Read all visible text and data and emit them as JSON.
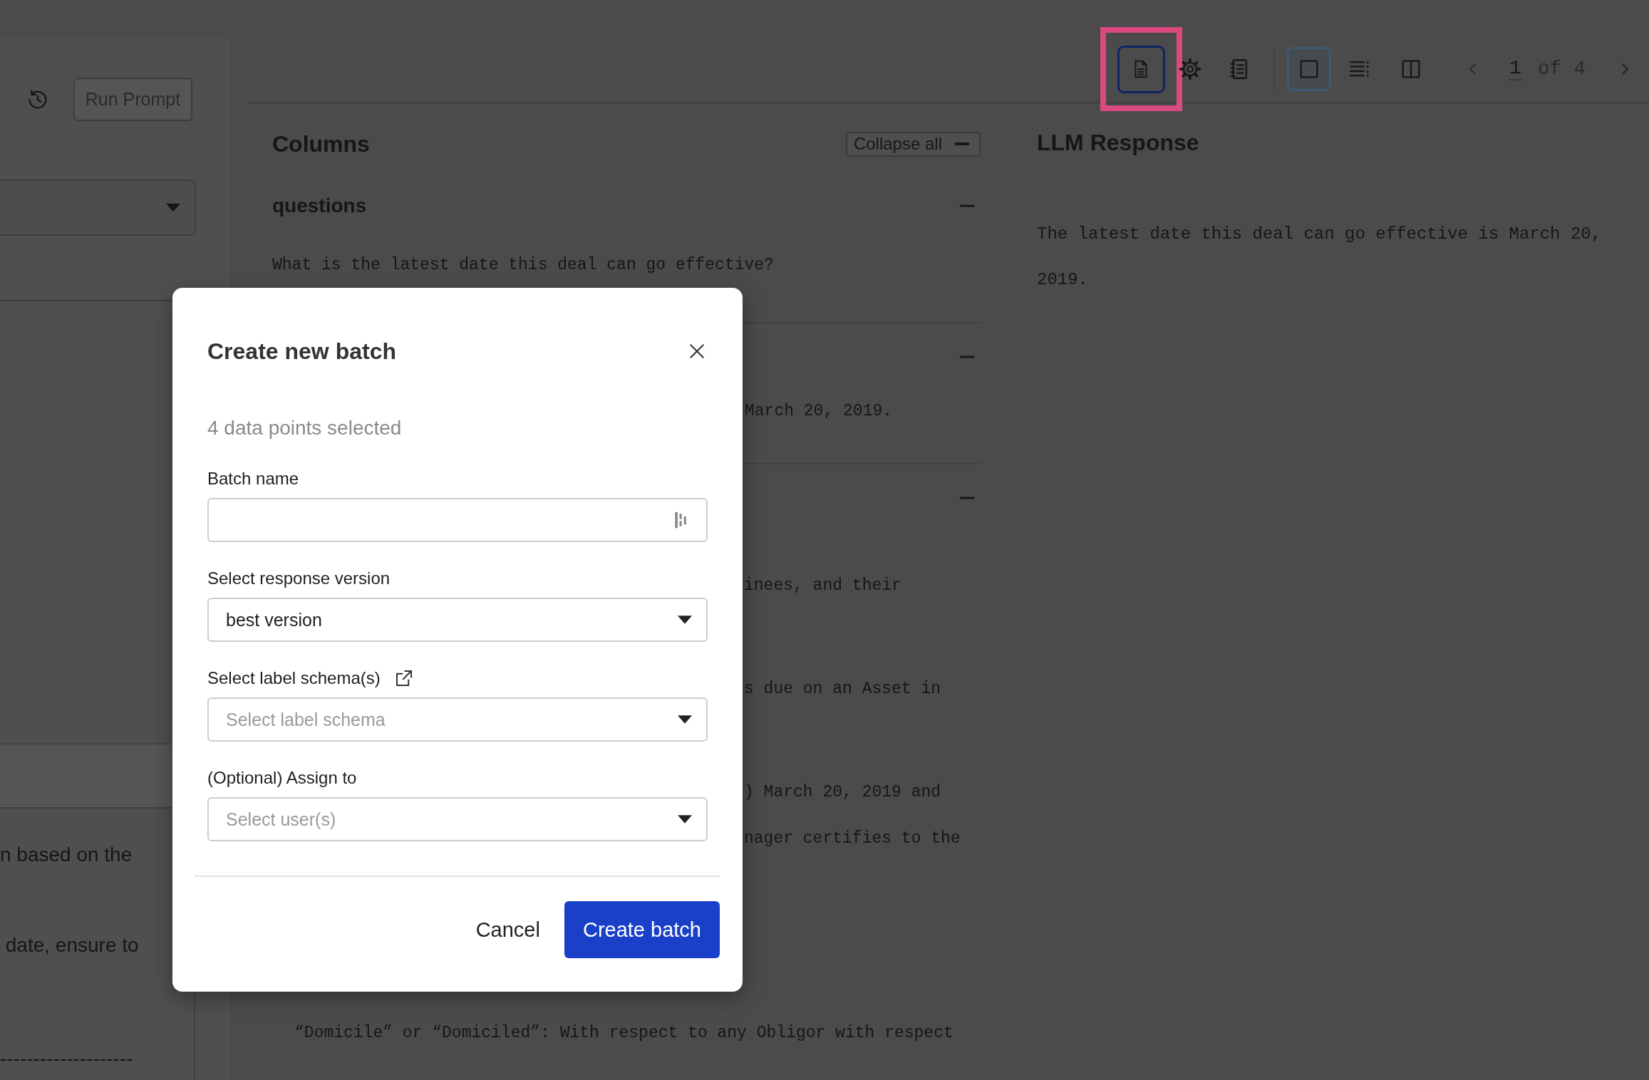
{
  "left_panel": {
    "run_button": {
      "label": "Run Prompt",
      "disabled": true
    },
    "text_lines": [
      "n based on the",
      " date, ensure to",
      "--------------------"
    ]
  },
  "toolbar": {
    "tools": [
      {
        "kind": "document",
        "selected": true,
        "highlighted": true
      },
      {
        "kind": "settings",
        "selected": false,
        "highlighted": false
      },
      {
        "kind": "notebook",
        "selected": false,
        "highlighted": false
      }
    ],
    "views": [
      {
        "kind": "single",
        "selected": true
      },
      {
        "kind": "list",
        "selected": false
      },
      {
        "kind": "split",
        "selected": false
      }
    ],
    "page": "1",
    "page_total": "of 4"
  },
  "columns": {
    "title": "Columns",
    "collapse_button": "Collapse all",
    "sections": [
      {
        "title": "questions",
        "expanded": true,
        "paragraphs": [
          [
            "What is the latest date this deal can go effective?"
          ]
        ]
      },
      {
        "expanded": true,
        "paragraphs": [
          [
            "March 20, 2019."
          ]
        ]
      },
      {
        "expanded": true,
        "paragraphs": [
          [
            "inees, and their"
          ],
          [
            "s due on an Asset in"
          ],
          [
            ") March 20, 2019 and",
            "nager certifies to the"
          ],
          [
            "“Domicile” or “Domiciled”: With respect to any Obligor with respect"
          ]
        ]
      }
    ]
  },
  "response": {
    "title": "LLM Response",
    "text": "The latest date this deal can go effective is March 20, 2019."
  },
  "dialog": {
    "title": "Create new batch",
    "subtitle": "4 data points selected",
    "fields": [
      {
        "kind": "text",
        "label": "Batch name",
        "link_icon": false
      },
      {
        "kind": "select",
        "label": "Select response version",
        "value": "best version",
        "link_icon": false
      },
      {
        "kind": "select",
        "label": "Select label schema(s)",
        "placeholder": "Select label schema",
        "link_icon": true
      },
      {
        "kind": "select",
        "label": "(Optional) Assign to",
        "placeholder": "Select user(s)",
        "link_icon": false
      }
    ],
    "buttons": [
      {
        "kind": "secondary",
        "label": "Cancel"
      },
      {
        "kind": "primary",
        "label": "Create batch"
      }
    ]
  }
}
